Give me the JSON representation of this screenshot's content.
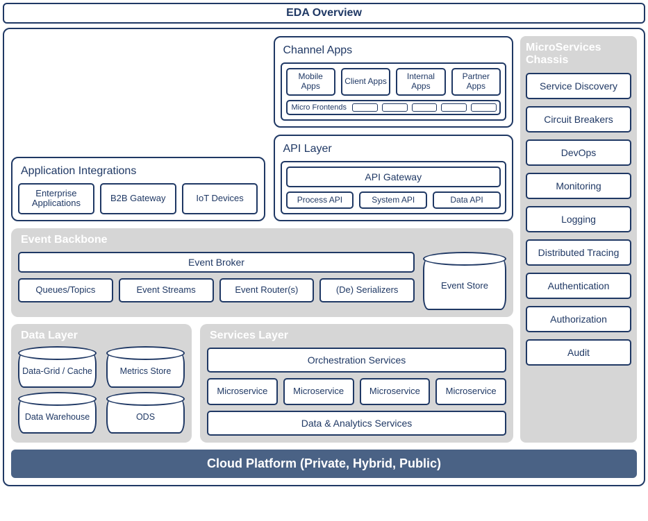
{
  "title": "EDA Overview",
  "appIntegrations": {
    "title": "Application Integrations",
    "items": [
      "Enterprise Applications",
      "B2B Gateway",
      "IoT Devices"
    ]
  },
  "channelApps": {
    "title": "Channel Apps",
    "items": [
      "Mobile Apps",
      "Client Apps",
      "Internal Apps",
      "Partner Apps"
    ],
    "microFrontends": "Micro Frontends"
  },
  "apiLayer": {
    "title": "API Layer",
    "gateway": "API Gateway",
    "items": [
      "Process API",
      "System API",
      "Data API"
    ]
  },
  "eventBackbone": {
    "title": "Event Backbone",
    "broker": "Event Broker",
    "items": [
      "Queues/Topics",
      "Event Streams",
      "Event Router(s)",
      "(De) Serializers"
    ],
    "store": "Event Store"
  },
  "dataLayer": {
    "title": "Data Layer",
    "items": [
      "Data-Grid / Cache",
      "Metrics Store",
      "Data Warehouse",
      "ODS"
    ]
  },
  "servicesLayer": {
    "title": "Services Layer",
    "orchestration": "Orchestration Services",
    "microservice": "Microservice",
    "dataAnalytics": "Data & Analytics Services"
  },
  "chassis": {
    "title": "MicroServices Chassis",
    "items": [
      "Service Discovery",
      "Circuit Breakers",
      "DevOps",
      "Monitoring",
      "Logging",
      "Distributed Tracing",
      "Authentication",
      "Authorization",
      "Audit"
    ]
  },
  "cloud": "Cloud Platform (Private, Hybrid, Public)"
}
